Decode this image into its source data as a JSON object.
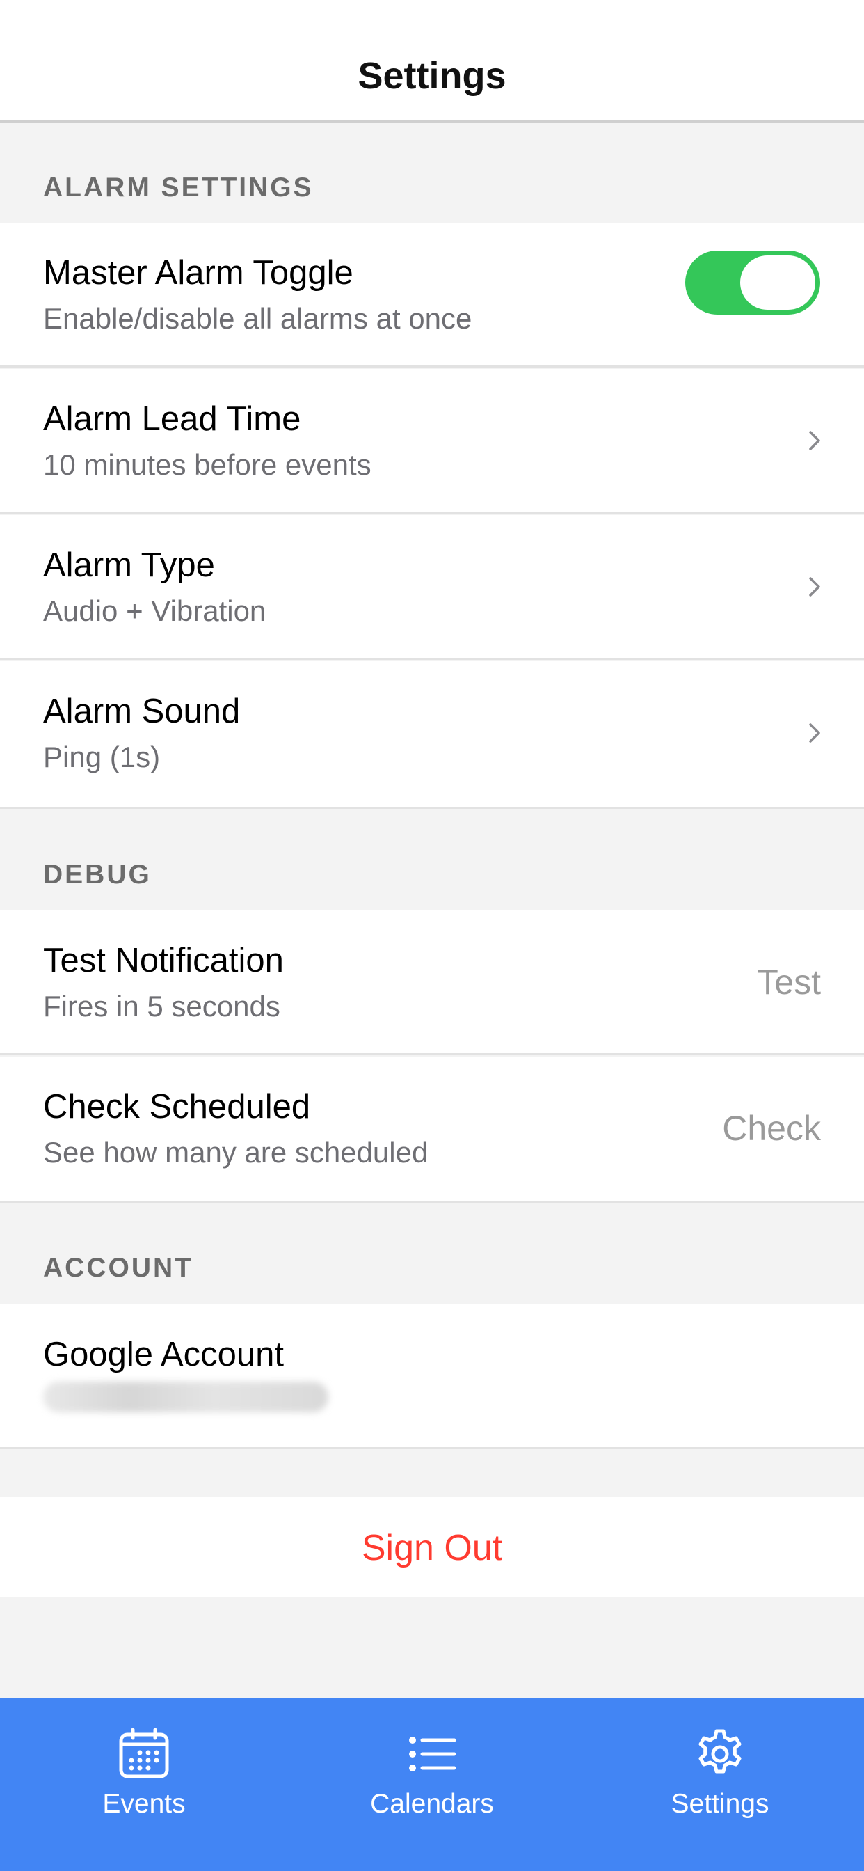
{
  "header": {
    "title": "Settings"
  },
  "sections": {
    "alarm_settings": "ALARM SETTINGS",
    "debug": "DEBUG",
    "account": "ACCOUNT"
  },
  "alarm": {
    "master": {
      "title": "Master Alarm Toggle",
      "subtitle": "Enable/disable all alarms at once",
      "enabled": true
    },
    "lead_time": {
      "title": "Alarm Lead Time",
      "subtitle": "10 minutes before events"
    },
    "type": {
      "title": "Alarm Type",
      "subtitle": "Audio + Vibration"
    },
    "sound": {
      "title": "Alarm Sound",
      "subtitle": "Ping (1s)"
    }
  },
  "debug": {
    "test_notification": {
      "title": "Test Notification",
      "subtitle": "Fires in 5 seconds",
      "action": "Test"
    },
    "check_scheduled": {
      "title": "Check Scheduled",
      "subtitle": "See how many are scheduled",
      "action": "Check"
    }
  },
  "account": {
    "google": {
      "title": "Google Account"
    },
    "sign_out": "Sign Out"
  },
  "tabs": [
    {
      "label": "Events",
      "icon": "calendar-icon"
    },
    {
      "label": "Calendars",
      "icon": "list-icon"
    },
    {
      "label": "Settings",
      "icon": "gear-icon"
    }
  ],
  "colors": {
    "toggle_on": "#34c759",
    "tab_bar": "#4285f4",
    "destructive": "#ff3b30"
  }
}
